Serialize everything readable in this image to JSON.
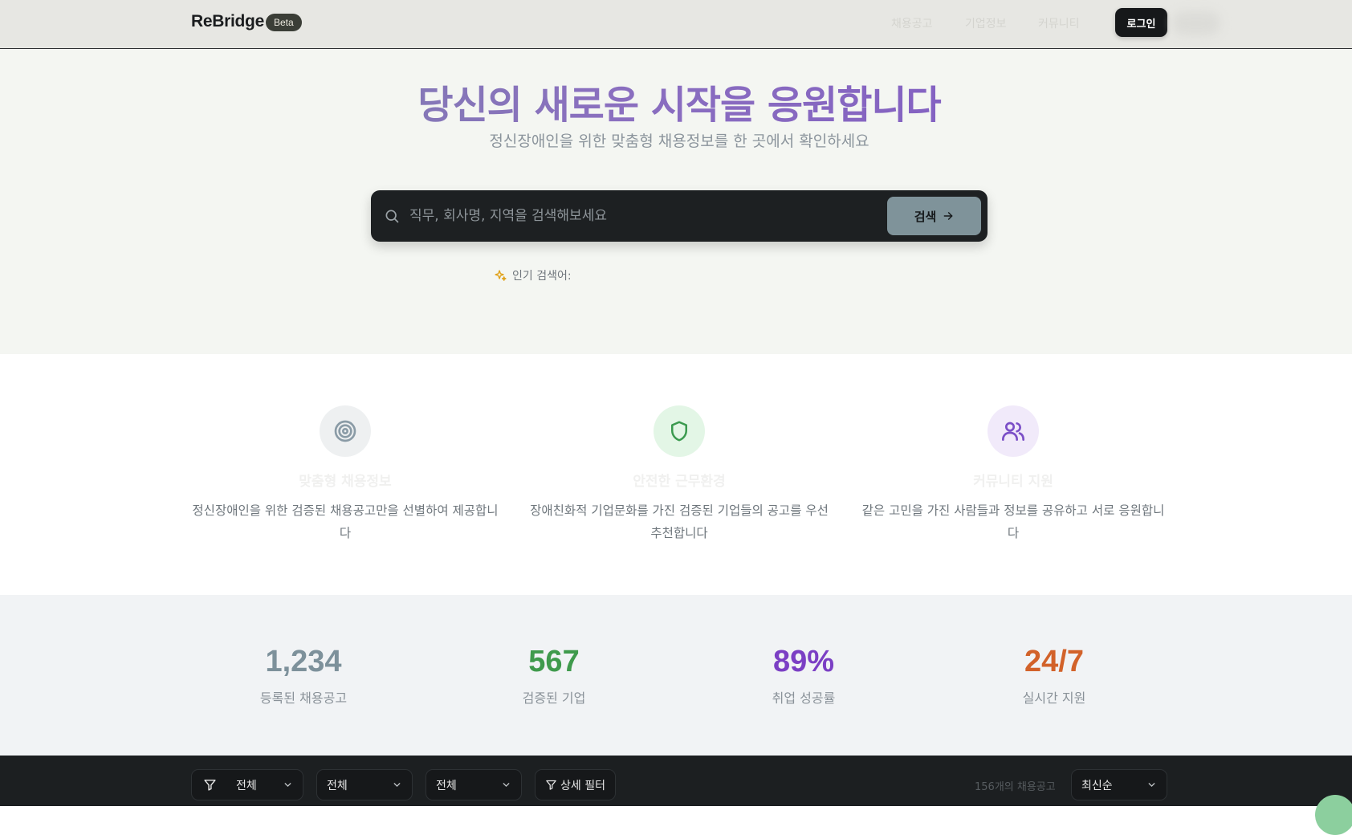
{
  "header": {
    "logo": "ReBridge",
    "badge": "Beta",
    "nav": [
      "채용공고",
      "기업정보",
      "커뮤니티"
    ],
    "login_label": "로그인"
  },
  "hero": {
    "title": "당신의 새로운 시작을 응원합니다",
    "subtitle": "정신장애인을 위한 맞춤형 채용정보를 한 곳에서 확인하세요",
    "search_placeholder": "직무, 회사명, 지역을 검색해보세요",
    "search_button": "검색",
    "popular_label": "인기 검색어:"
  },
  "features": [
    {
      "icon": "target-icon",
      "title": "맞춤형 채용정보",
      "desc": "정신장애인을 위한 검증된 채용공고만을 선별하여 제공합니다",
      "color": "#8a9ba6",
      "bg": "#eef0f1"
    },
    {
      "icon": "shield-icon",
      "title": "안전한 근무환경",
      "desc": "장애친화적 기업문화를 가진 검증된 기업들의 공고를 우선 추천합니다",
      "color": "#3b9a4f",
      "bg": "#e3f6e6"
    },
    {
      "icon": "users-icon",
      "title": "커뮤니티 지원",
      "desc": "같은 고민을 가진 사람들과 정보를 공유하고 서로 응원합니다",
      "color": "#7b4fc7",
      "bg": "#f1eafa"
    }
  ],
  "stats": [
    {
      "value": "1,234",
      "label": "등록된 채용공고",
      "color": "#7d919b"
    },
    {
      "value": "567",
      "label": "검증된 기업",
      "color": "#3f9a4c"
    },
    {
      "value": "89%",
      "label": "취업 성공률",
      "color": "#7b3fc4"
    },
    {
      "value": "24/7",
      "label": "실시간 지원",
      "color": "#d2622a"
    }
  ],
  "filters": {
    "filter1": "전체",
    "filter2": "전체",
    "filter3": "전체",
    "detail_filter": "상세 필터",
    "count": "156개의 채용공고",
    "sort": "최신순"
  }
}
